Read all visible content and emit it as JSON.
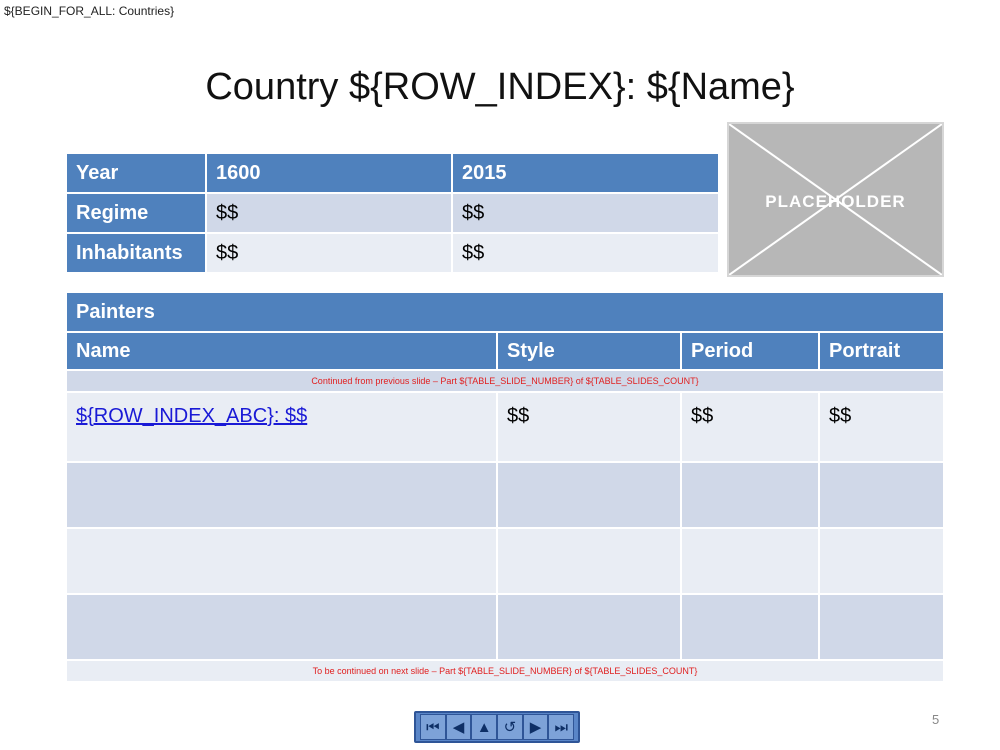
{
  "marker": "${BEGIN_FOR_ALL: Countries}",
  "title": "Country ${ROW_INDEX}: ${Name}",
  "info_table": {
    "header": [
      "Year",
      "1600",
      "2015"
    ],
    "rows": [
      [
        "Regime",
        "$$",
        "$$"
      ],
      [
        "Inhabitants",
        "$$",
        "$$"
      ]
    ]
  },
  "placeholder": {
    "label": "PLACEHOLDER"
  },
  "painters_table": {
    "title": "Painters",
    "columns": [
      "Name",
      "Style",
      "Period",
      "Portrait"
    ],
    "continued_from": "Continued from previous slide – Part ${TABLE_SLIDE_NUMBER} of ${TABLE_SLIDES_COUNT}",
    "row": [
      "${ROW_INDEX_ABC}: $$",
      "$$",
      "$$",
      "$$"
    ],
    "continued_to": "To be continued on next slide – Part ${TABLE_SLIDE_NUMBER} of ${TABLE_SLIDES_COUNT}"
  },
  "nav": {
    "icons": [
      "first-icon",
      "previous-icon",
      "home-icon",
      "return-icon",
      "next-icon",
      "last-icon"
    ],
    "glyphs": [
      "⏮",
      "◀",
      "▲",
      "↺",
      "▶",
      "⏭"
    ]
  },
  "page_number": "5",
  "colors": {
    "header": "#4f81bd",
    "row_dark": "#d0d8e8",
    "row_light": "#e9edf4",
    "note": "#e02020",
    "link": "#1a1ad6"
  }
}
